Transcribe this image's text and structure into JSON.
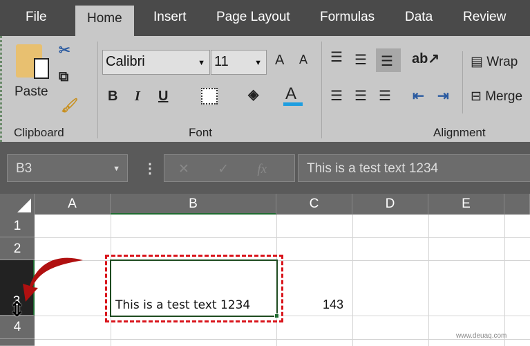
{
  "tabs": [
    "File",
    "Home",
    "Insert",
    "Page Layout",
    "Formulas",
    "Data",
    "Review"
  ],
  "active_tab": "Home",
  "ribbon": {
    "clipboard": {
      "paste_label": "Paste",
      "group_label": "Clipboard"
    },
    "font": {
      "font_name": "Calibri",
      "font_size": "11",
      "group_label": "Font",
      "bold": "B",
      "italic": "I",
      "underline": "U",
      "grow": "A",
      "shrink": "A",
      "font_color": "A",
      "font_color_hex": "#1e9ee0"
    },
    "alignment": {
      "wrap_label": "Wrap",
      "merge_label": "Merge",
      "group_label": "Alignment"
    }
  },
  "formula_bar": {
    "name_box": "B3",
    "fx": "fx",
    "cancel": "✕",
    "enter": "✓",
    "value": "This is a test text 1234"
  },
  "columns": [
    "A",
    "B",
    "C",
    "D",
    "E"
  ],
  "rows": [
    "1",
    "2",
    "3",
    "4"
  ],
  "cells": {
    "B3": "This is a test text 1234",
    "C3": "143"
  },
  "highlight_color": "#d9141b",
  "watermark": "www.deuaq.com"
}
